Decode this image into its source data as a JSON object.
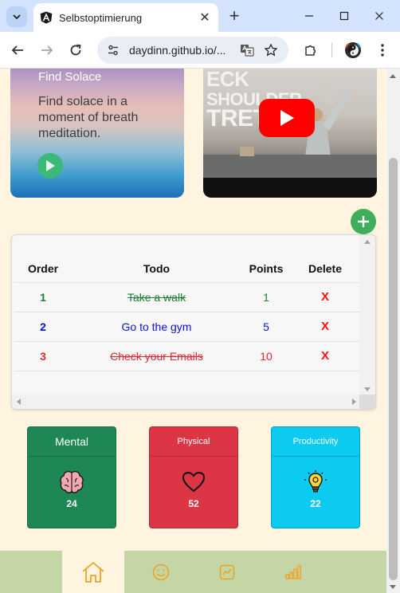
{
  "browser": {
    "tab_title": "Selbstoptimierung",
    "url": "daydinn.github.io/...",
    "colors": {
      "tabstrip": "#d3e3fd",
      "toolbar": "#ffffff"
    }
  },
  "page": {
    "background": "#fff4e0",
    "solace_card": {
      "title": "Find Solace",
      "text": "Find solace in a moment of breath meditation.",
      "play_icon": "play-circle-icon"
    },
    "video_card": {
      "line1": "ECK",
      "line2": "SHOULDER",
      "line3": "TRET",
      "play_icon": "youtube-play-icon"
    },
    "add_icon": "plus-circle-icon",
    "todo_table": {
      "headers": {
        "order": "Order",
        "todo": "Todo",
        "points": "Points",
        "delete": "Delete"
      },
      "rows": [
        {
          "order": "1",
          "todo": "Take a walk",
          "points": "1",
          "delete": "X",
          "color": "#1e7e34",
          "done": true
        },
        {
          "order": "2",
          "todo": "Go to the gym",
          "points": "5",
          "delete": "X",
          "color": "#1010d6",
          "done": false
        },
        {
          "order": "3",
          "todo": "Check your Emails",
          "points": "10",
          "delete": "X",
          "color": "#e3262f",
          "done": true
        }
      ]
    },
    "stats": [
      {
        "label": "Mental",
        "value": "24",
        "icon": "brain-icon",
        "color": "#1e8753"
      },
      {
        "label": "Physical",
        "value": "52",
        "icon": "heart-icon",
        "color": "#dc3545"
      },
      {
        "label": "Productivity",
        "value": "22",
        "icon": "lightbulb-icon",
        "color": "#0dcaf0"
      }
    ],
    "bottom_nav": {
      "items": [
        {
          "icon": "home-icon",
          "active": true
        },
        {
          "icon": "smiley-icon",
          "active": false
        },
        {
          "icon": "chart-line-icon",
          "active": false
        },
        {
          "icon": "bar-chart-icon",
          "active": false
        }
      ],
      "background": "#c4d6a6",
      "icon_color": "#f0a022"
    }
  }
}
